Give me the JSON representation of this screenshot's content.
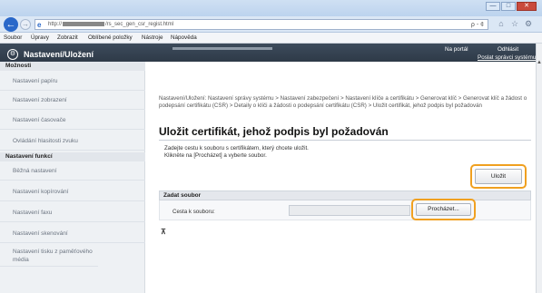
{
  "browser": {
    "address_prefix": "http://",
    "address_suffix": "/rs_sec_gen_csr_regist.html",
    "search_tools": "ρ - ¢",
    "window_buttons": [
      "—",
      "□",
      "✕"
    ],
    "menu": [
      "Soubor",
      "Úpravy",
      "Zobrazit",
      "Oblíbené položky",
      "Nástroje",
      "Nápověda"
    ]
  },
  "header": {
    "title": "Nastavení/Uložení",
    "portal_link": "Na portál",
    "logout_link": "Odhlásit",
    "admin_mail_link": "Poslat správci systému"
  },
  "sidebar": {
    "section_preferences": "Možnosti",
    "preferences_items": [
      "Nastavení papíru",
      "Nastavení zobrazení",
      "Nastavení časovače",
      "Ovládání hlasitosti zvuku"
    ],
    "section_functions": "Nastavení funkcí",
    "functions_items": [
      "Běžná nastavení",
      "Nastavení kopírování",
      "Nastavení faxu",
      "Nastavení skenování",
      "Nastavení tisku z paměťového média"
    ]
  },
  "main": {
    "breadcrumb": "Nastavení/Uložení: Nastavení správy systému > Nastavení zabezpečení > Nastavení klíče a certifikátu > Generovat klíč > Generovat klíč a žádost o podepsání certifikátu (CSR) > Detaily o klíči a žádosti o podepsání certifikátu (CSR) > Uložit certifikát, jehož podpis byl požadován",
    "title": "Uložit certifikát, jehož podpis byl požadován",
    "instruction_line1": "Zadejte cestu k souboru s certifikátem, který chcete uložit.",
    "instruction_line2": "Klikněte na [Procházet] a vyberte soubor.",
    "save_button": "Uložit",
    "section_title": "Zadat soubor",
    "file_path_label": "Cesta k souboru:",
    "file_path_value": "",
    "browse_button": "Procházet..."
  },
  "colors": {
    "highlight": "#f0a020",
    "header_bg": "#2e3a48",
    "back_button": "#2a68c9"
  }
}
